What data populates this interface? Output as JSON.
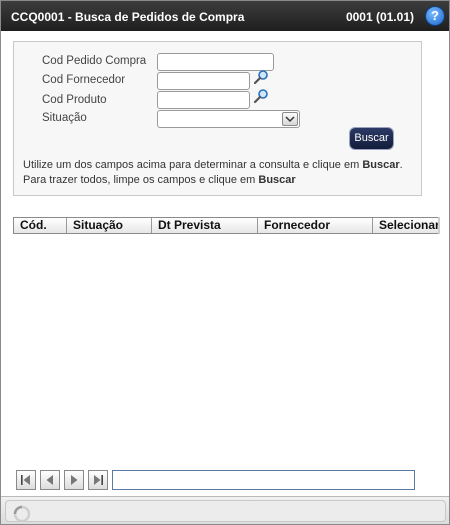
{
  "window": {
    "title": "CCQ0001 - Busca de Pedidos de Compra",
    "version": "0001 (01.01)",
    "help_glyph": "?"
  },
  "form": {
    "fields": [
      {
        "label": "Cod Pedido Compra",
        "value": ""
      },
      {
        "label": "Cod Fornecedor",
        "value": ""
      },
      {
        "label": "Cod Produto",
        "value": ""
      },
      {
        "label": "Situação",
        "value": ""
      }
    ],
    "search_button": "Buscar",
    "help_line1_prefix": "Utilize um dos campos acima para determinar a consulta e clique em ",
    "help_line1_bold": "Buscar",
    "help_line1_suffix": ".",
    "help_line2_prefix": "Para trazer todos, limpe os campos e clique em ",
    "help_line2_bold": "Buscar"
  },
  "grid": {
    "columns": [
      "Cód.",
      "Situação",
      "Dt Prevista",
      "Fornecedor",
      "Selecionar"
    ],
    "rows": []
  },
  "pager": {
    "buttons": [
      "first-page-icon",
      "prev-page-icon",
      "next-page-icon",
      "last-page-icon"
    ],
    "value": ""
  },
  "colors": {
    "titlebar": "#2b2b2b",
    "search_button": "#1e2a52",
    "help_icon": "#1f6fd6"
  }
}
